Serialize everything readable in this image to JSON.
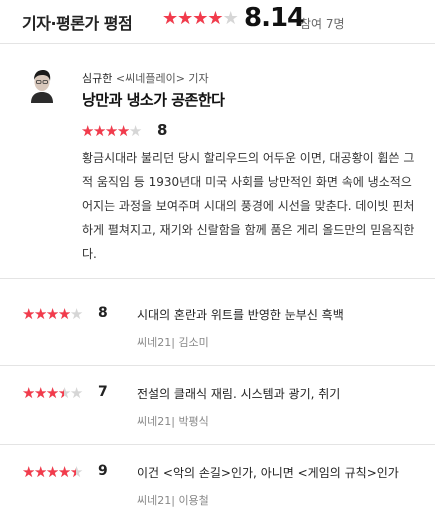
{
  "header": {
    "title": "기자·평론가 평점",
    "score": "8.14",
    "participants": "참여 7명",
    "star_rating_fraction": 0.8
  },
  "featured": {
    "author": "심규한",
    "outlet": "<씨네플레이>",
    "role": "기자",
    "title": "낭만과 냉소가 공존한다",
    "score": "8",
    "star_rating_fraction": 0.8,
    "body_lines": [
      "황금시대라 불리던 당시 할리우드의 어두운 이면, 대공황이 휩쓴 그",
      "적 움직임 등 1930년대 미국 사회를 낭만적인 화면 속에 냉소적으",
      "어지는 과정을 보여주며 시대의 풍경에 시선을 맞춘다. 데이빗 핀처",
      "하게 펼쳐지고, 재기와 신랄함을 함께 품은 게리 올드만의 믿음직한",
      "다."
    ]
  },
  "reviews": [
    {
      "score": "8",
      "star_rating_fraction": 0.8,
      "text": "시대의 혼란과 위트를 반영한 눈부신 흑백",
      "source": "씨네21| 김소미"
    },
    {
      "score": "7",
      "star_rating_fraction": 0.7,
      "text": "전설의 클래식 재림. 시스템과 광기, 취기",
      "source": "씨네21| 박평식"
    },
    {
      "score": "9",
      "star_rating_fraction": 0.9,
      "text": "이건 <악의 손길>인가, 아니면 <게임의 규칙>인가",
      "source": "씨네21| 이용철"
    }
  ],
  "colors": {
    "star_filled": "#f23b4c",
    "star_empty": "#d6d6d6",
    "divider": "#e4e4e4"
  },
  "icons": {
    "avatar": "portrait-photo"
  }
}
